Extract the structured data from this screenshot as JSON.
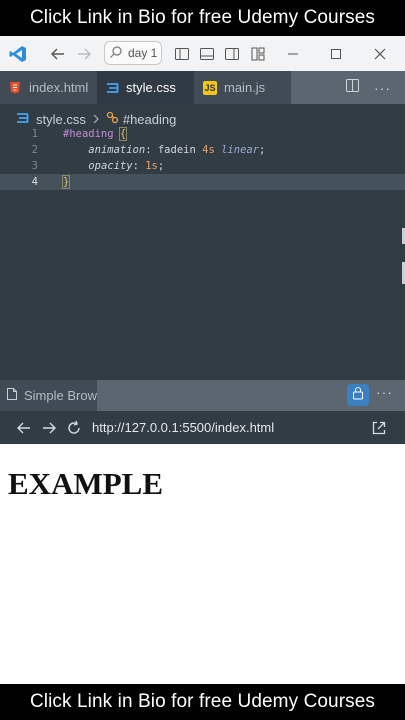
{
  "banner": {
    "top_text": "Click Link in Bio for free Udemy Courses",
    "bottom_text": "Click Link in Bio for free Udemy Courses"
  },
  "titlebar": {
    "app_icon": "vscode-logo-icon",
    "search_text": "day 1"
  },
  "tabs": [
    {
      "label": "index.html",
      "icon": "html-file-icon",
      "active": false
    },
    {
      "label": "style.css",
      "icon": "css-file-icon",
      "active": true
    },
    {
      "label": "main.js",
      "icon": "js-file-icon",
      "active": false
    }
  ],
  "editor": {
    "breadcrumb": {
      "file": "style.css",
      "symbol": "#heading"
    },
    "lines": [
      {
        "number": "1",
        "selector": "#heading",
        "brace": "{"
      },
      {
        "number": "2",
        "property": "animation",
        "value_name": "fadein",
        "value_time": "4s",
        "value_fn": "linear"
      },
      {
        "number": "3",
        "property": "opacity",
        "value_time": "1s"
      },
      {
        "number": "4",
        "brace": "}"
      }
    ]
  },
  "browser": {
    "tab_label": "Simple Brow",
    "url": "http://127.0.0.1:5500/index.html",
    "page_heading": "EXAMPLE"
  },
  "colors": {
    "accent": "#3b7fc4",
    "editor_bg": "#313c45",
    "selector": "#c58ad8",
    "number": "#e5a36f"
  }
}
